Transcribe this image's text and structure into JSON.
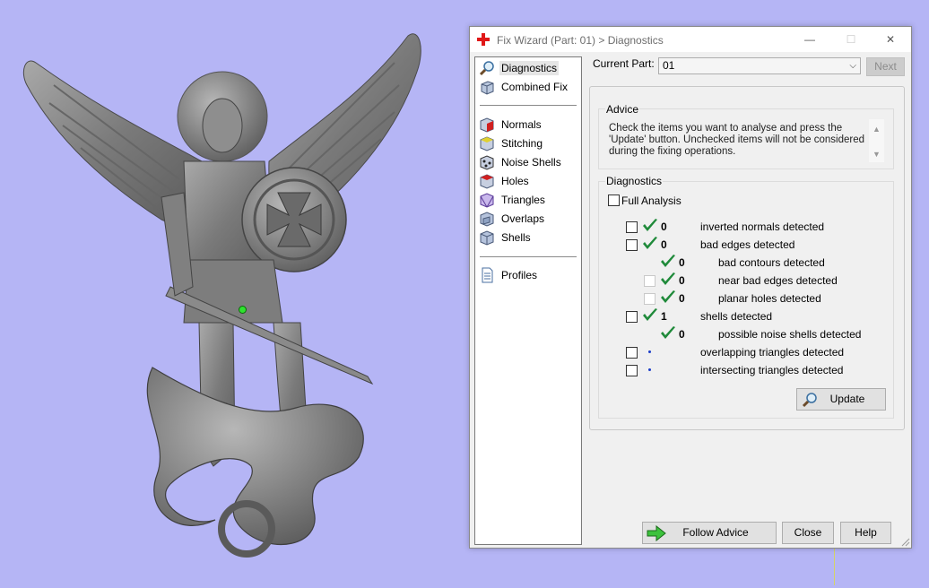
{
  "window": {
    "title": "Fix Wizard (Part: 01) > Diagnostics",
    "minimize_glyph": "—",
    "maximize_glyph": "☐",
    "close_glyph": "✕"
  },
  "nav": {
    "items": [
      {
        "label": "Diagnostics",
        "icon": "magnifier-icon",
        "selected": true
      },
      {
        "label": "Combined Fix",
        "icon": "cube-fix-icon"
      },
      {
        "label": "Normals",
        "icon": "normals-cube-icon"
      },
      {
        "label": "Stitching",
        "icon": "stitching-cube-icon"
      },
      {
        "label": "Noise Shells",
        "icon": "noise-shells-icon"
      },
      {
        "label": "Holes",
        "icon": "holes-cube-icon"
      },
      {
        "label": "Triangles",
        "icon": "triangles-cube-icon"
      },
      {
        "label": "Overlaps",
        "icon": "overlaps-cube-icon"
      },
      {
        "label": "Shells",
        "icon": "shells-cube-icon"
      },
      {
        "label": "Profiles",
        "icon": "document-icon"
      }
    ]
  },
  "current_part": {
    "label": "Current Part:",
    "value": "01",
    "next_label": "Next"
  },
  "advice": {
    "title": "Advice",
    "text": "Check the items you want to analyse and press the 'Update' button. Unchecked items will not be considered during the fixing operations."
  },
  "diagnostics": {
    "title": "Diagnostics",
    "full_analysis_label": "Full Analysis",
    "rows": [
      {
        "label": "inverted normals detected",
        "count": "0",
        "status": "ok",
        "indent": false
      },
      {
        "label": "bad edges detected",
        "count": "0",
        "status": "ok",
        "indent": false
      },
      {
        "label": "bad contours detected",
        "count": "0",
        "status": "ok",
        "indent": true
      },
      {
        "label": "near bad edges detected",
        "count": "0",
        "status": "ok",
        "indent": true
      },
      {
        "label": "planar holes detected",
        "count": "0",
        "status": "ok",
        "indent": true
      },
      {
        "label": "shells detected",
        "count": "1",
        "status": "ok",
        "indent": false
      },
      {
        "label": "possible noise shells detected",
        "count": "0",
        "status": "ok",
        "indent": true
      },
      {
        "label": "overlapping triangles detected",
        "count": "",
        "status": "pending",
        "indent": false
      },
      {
        "label": "intersecting triangles detected",
        "count": "",
        "status": "pending",
        "indent": false
      }
    ],
    "update_label": "Update"
  },
  "footer": {
    "follow_advice_label": "Follow Advice",
    "close_label": "Close",
    "help_label": "Help"
  },
  "colors": {
    "viewport_bg": "#b5b5f5",
    "check_green": "#1f8a3a",
    "pending_dot": "#1a3cc8"
  }
}
